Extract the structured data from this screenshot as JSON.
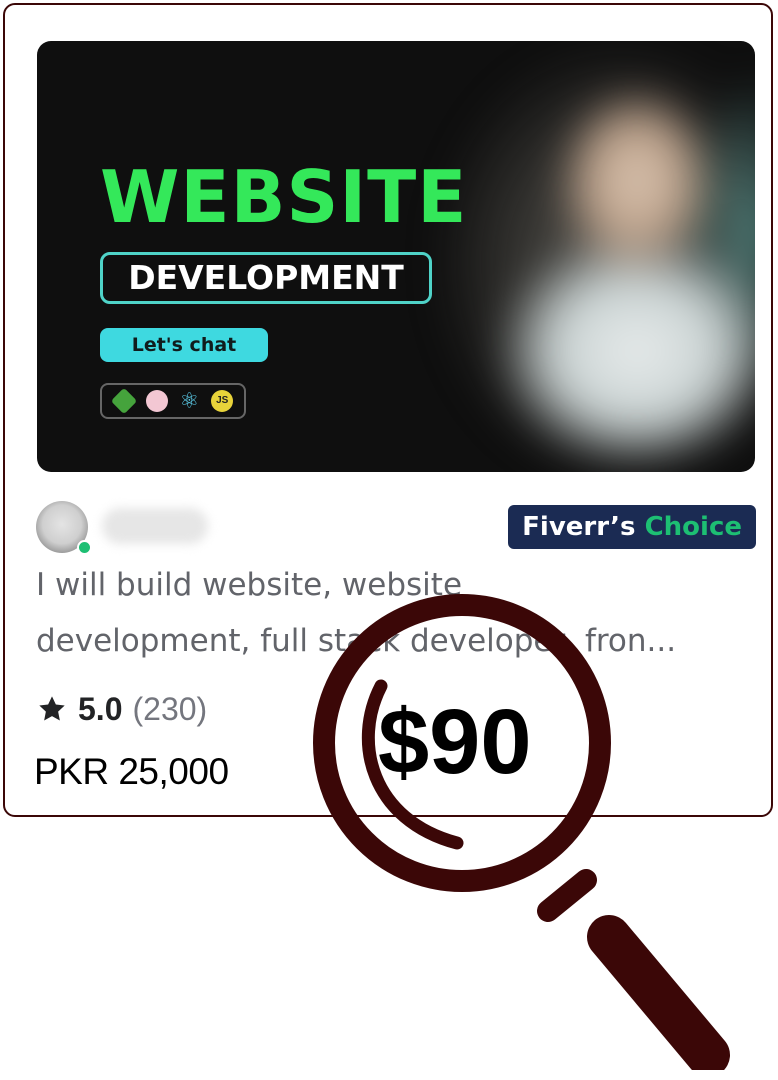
{
  "gig_card": {
    "thumbnail": {
      "headline_primary": "WEBSITE",
      "headline_secondary": "DEVELOPMENT",
      "cta_label": "Let's chat",
      "tech_icons": [
        "nodejs-icon",
        "sass-icon",
        "react-icon",
        "javascript-icon"
      ],
      "js_label": "JS",
      "react_glyph": "⚛"
    },
    "seller": {
      "avatar_icon": "avatar-icon",
      "online_color": "#1dbf73"
    },
    "badge": {
      "label_prefix": "Fiverr’s",
      "label_suffix": "Choice",
      "background_color": "#1b2b53",
      "accent_color": "#1dbf73"
    },
    "title_lines": [
      "I will build website, website",
      "development, full stack developer, fron..."
    ],
    "rating": {
      "icon": "star-icon",
      "value": "5.0",
      "reviews": "(230)"
    },
    "price": "PKR 25,000"
  },
  "overlay": {
    "icon": "magnifier-icon",
    "price_usd": "$90",
    "color": "#3b0707"
  }
}
